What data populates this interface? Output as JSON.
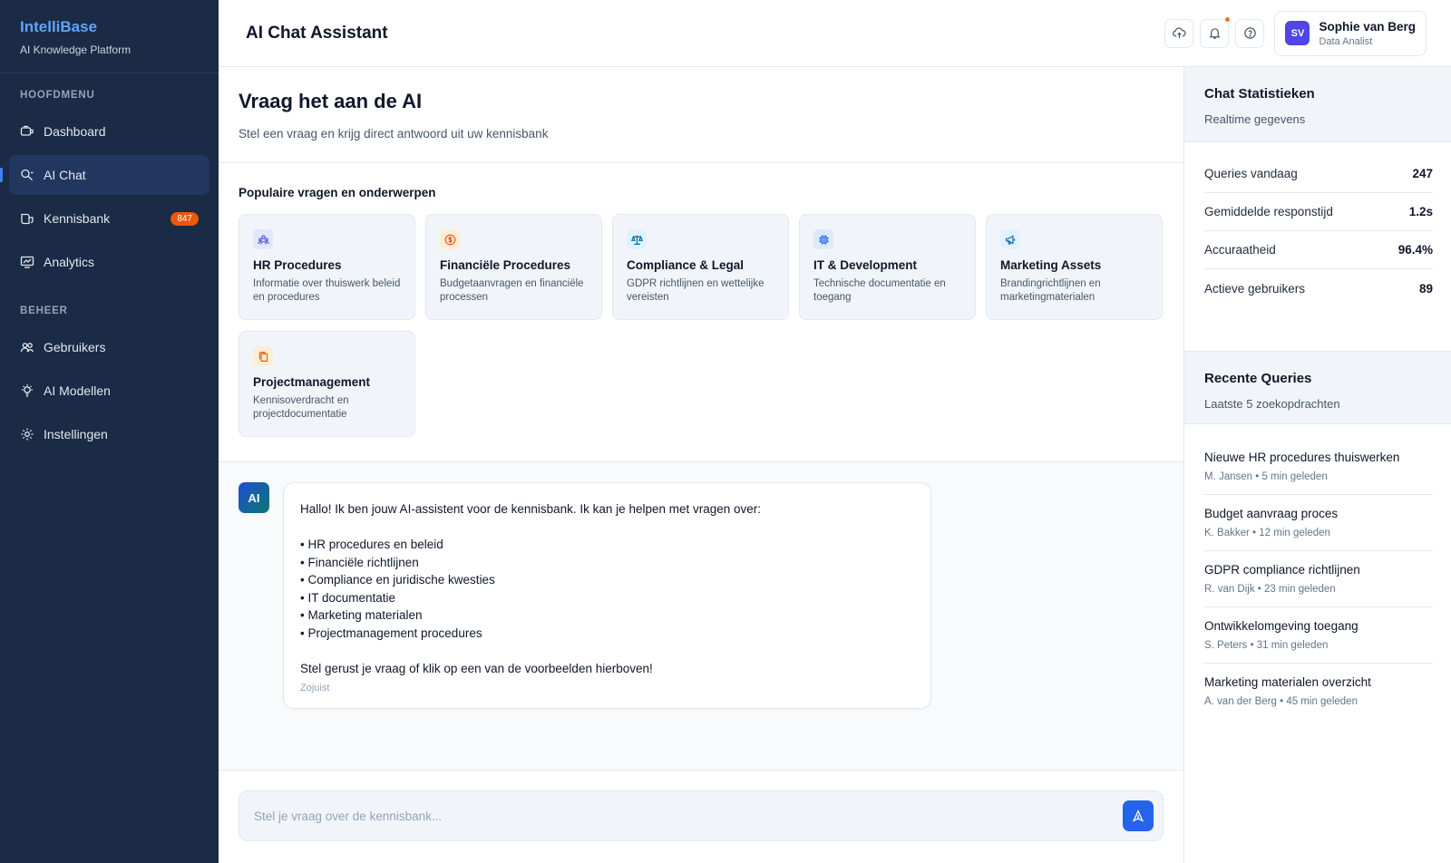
{
  "brand": {
    "name": "IntelliBase",
    "subtitle": "AI Knowledge Platform"
  },
  "sidebar": {
    "sections": [
      {
        "label": "HOOFDMENU"
      },
      {
        "label": "BEHEER"
      }
    ],
    "main_items": [
      {
        "label": "Dashboard",
        "icon": "dashboard-icon"
      },
      {
        "label": "AI Chat",
        "icon": "chat-icon",
        "active": true
      },
      {
        "label": "Kennisbank",
        "icon": "book-icon",
        "badge": "847"
      },
      {
        "label": "Analytics",
        "icon": "chart-icon"
      }
    ],
    "admin_items": [
      {
        "label": "Gebruikers",
        "icon": "users-icon"
      },
      {
        "label": "AI Modellen",
        "icon": "bulb-icon"
      },
      {
        "label": "Instellingen",
        "icon": "gear-icon"
      }
    ]
  },
  "header": {
    "title": "AI Chat Assistant",
    "user": {
      "initials": "SV",
      "name": "Sophie van Berg",
      "role": "Data Analist"
    }
  },
  "hero": {
    "title": "Vraag het aan de AI",
    "subtitle": "Stel een vraag en krijg direct antwoord uit uw kennisbank"
  },
  "topics": {
    "title": "Populaire vragen en onderwerpen",
    "cards": [
      {
        "title": "HR Procedures",
        "desc": "Informatie over thuiswerk beleid en procedures",
        "icon": "people-icon",
        "color": "#4f46e5"
      },
      {
        "title": "Financiële Procedures",
        "desc": "Budgetaanvragen en financiële processen",
        "icon": "dollar-icon",
        "color": "#ea580c"
      },
      {
        "title": "Compliance & Legal",
        "desc": "GDPR richtlijnen en wettelijke vereisten",
        "icon": "scales-icon",
        "color": "#0369a1"
      },
      {
        "title": "IT & Development",
        "desc": "Technische documentatie en toegang",
        "icon": "chip-icon",
        "color": "#2563eb"
      },
      {
        "title": "Marketing Assets",
        "desc": "Brandingrichtlijnen en marketingmaterialen",
        "icon": "megaphone-icon",
        "color": "#0369a1"
      },
      {
        "title": "Projectmanagement",
        "desc": "Kennisoverdracht en projectdocumentatie",
        "icon": "copy-icon",
        "color": "#ea580c"
      }
    ]
  },
  "chat": {
    "avatar": "AI",
    "message": {
      "intro": "Hallo! Ik ben jouw AI-assistent voor de kennisbank. Ik kan je helpen met vragen over:",
      "bullets": [
        "• HR procedures en beleid",
        "• Financiële richtlijnen",
        "• Compliance en juridische kwesties",
        "• IT documentatie",
        "• Marketing materialen",
        "• Projectmanagement procedures"
      ],
      "outro": "Stel gerust je vraag of klik op een van de voorbeelden hierboven!",
      "time": "Zojuist"
    },
    "input_placeholder": "Stel je vraag over de kennisbank..."
  },
  "stats_panel": {
    "title": "Chat Statistieken",
    "subtitle": "Realtime gegevens",
    "rows": [
      {
        "label": "Queries vandaag",
        "value": "247"
      },
      {
        "label": "Gemiddelde responstijd",
        "value": "1.2s"
      },
      {
        "label": "Accuraatheid",
        "value": "96.4%"
      },
      {
        "label": "Actieve gebruikers",
        "value": "89"
      }
    ]
  },
  "recent_panel": {
    "title": "Recente Queries",
    "subtitle": "Laatste 5 zoekopdrachten",
    "items": [
      {
        "title": "Nieuwe HR procedures thuiswerken",
        "meta": "M. Jansen • 5 min geleden"
      },
      {
        "title": "Budget aanvraag proces",
        "meta": "K. Bakker • 12 min geleden"
      },
      {
        "title": "GDPR compliance richtlijnen",
        "meta": "R. van Dijk • 23 min geleden"
      },
      {
        "title": "Ontwikkelomgeving toegang",
        "meta": "S. Peters • 31 min geleden"
      },
      {
        "title": "Marketing materialen overzicht",
        "meta": "A. van der Berg • 45 min geleden"
      }
    ]
  },
  "colors": {
    "sidebar": "#1b2a45",
    "accent": "#2563eb",
    "badge": "#ea580c"
  }
}
